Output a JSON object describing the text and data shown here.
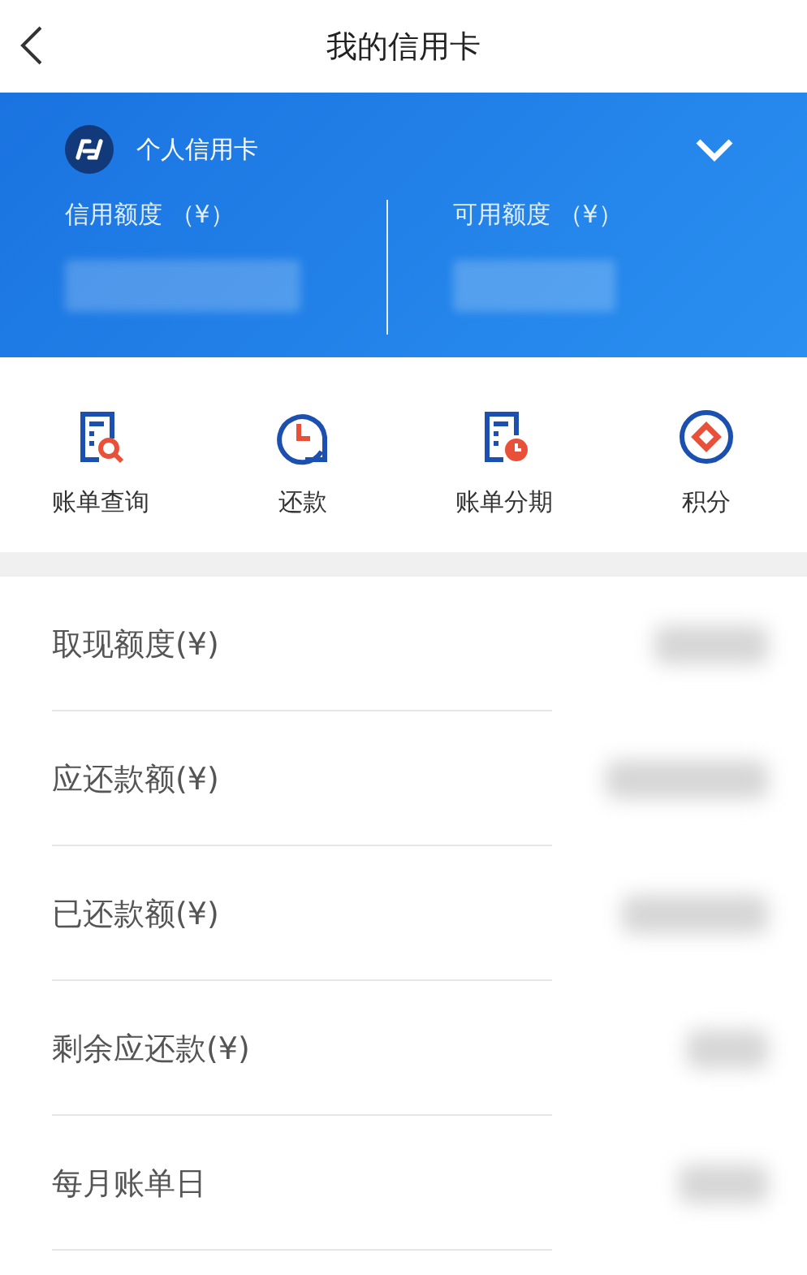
{
  "header": {
    "title": "我的信用卡"
  },
  "card": {
    "name": "个人信用卡",
    "limits": [
      {
        "label": "信用额度 （¥）"
      },
      {
        "label": "可用额度 （¥）"
      }
    ]
  },
  "actions": [
    {
      "label": "账单查询",
      "kind": "bill-search"
    },
    {
      "label": "还款",
      "kind": "repay"
    },
    {
      "label": "账单分期",
      "kind": "installment"
    },
    {
      "label": "积分",
      "kind": "points"
    }
  ],
  "details": [
    {
      "label": "取现额度(¥)"
    },
    {
      "label": "应还款额(¥)"
    },
    {
      "label": "已还款额(¥)"
    },
    {
      "label": "剩余应还款(¥)"
    },
    {
      "label": "每月账单日"
    }
  ]
}
